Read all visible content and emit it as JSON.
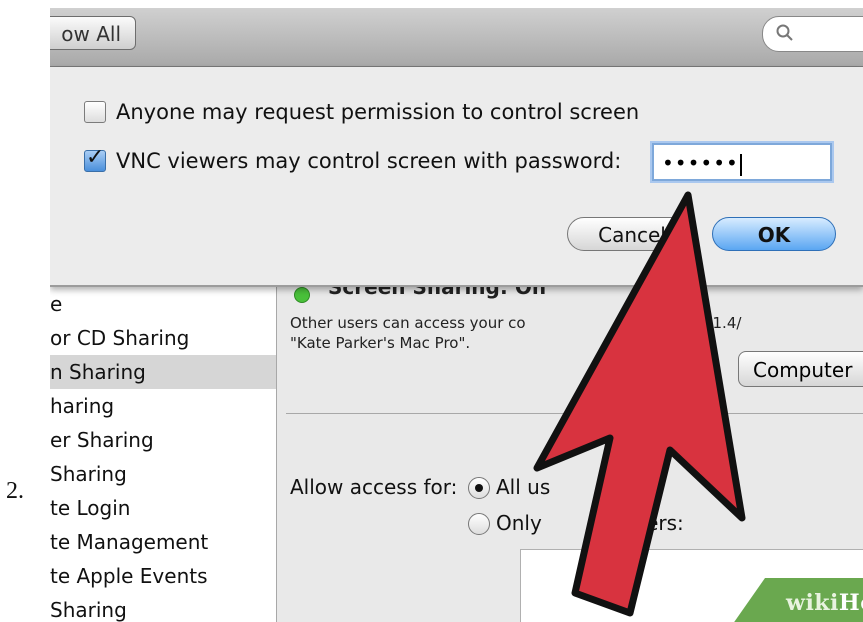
{
  "step_number": "2.",
  "toolbar": {
    "show_all_label": "ow All",
    "search_icon": "search-icon"
  },
  "sheet": {
    "options": [
      {
        "label": "Anyone may request permission to control screen",
        "checked": false
      },
      {
        "label": "VNC viewers may control screen with password:",
        "checked": true
      }
    ],
    "password_value": "••••••",
    "cancel_label": "Cancel",
    "ok_label": "OK"
  },
  "sidebar": {
    "items": [
      {
        "label": "e",
        "selected": false
      },
      {
        "label": "or CD Sharing",
        "selected": false
      },
      {
        "label": "n Sharing",
        "selected": true
      },
      {
        "label": "haring",
        "selected": false
      },
      {
        "label": "er Sharing",
        "selected": false
      },
      {
        "label": "Sharing",
        "selected": false
      },
      {
        "label": "te Login",
        "selected": false
      },
      {
        "label": "te Management",
        "selected": false
      },
      {
        "label": "te Apple Events",
        "selected": false
      },
      {
        "label": " Sharing",
        "selected": false
      }
    ]
  },
  "main": {
    "status": "Screen Sharing: On",
    "description_line1": "Other users can access your co",
    "description_ip": "//192.168.1.4/",
    "description_line2": "\"Kate Parker's Mac Pro\".",
    "computer_button": "Computer",
    "allow_access_label": "Allow access for:",
    "allow_all_label": "All us",
    "allow_only_label": "Only",
    "allow_only_suffix": "users:"
  },
  "watermark": {
    "wiki": "wiki",
    "how": "How"
  },
  "colors": {
    "arrow_fill": "#d8333f",
    "arrow_stroke": "#111111",
    "ok_button": "#5aa6f2",
    "status_green": "#49c03a"
  }
}
